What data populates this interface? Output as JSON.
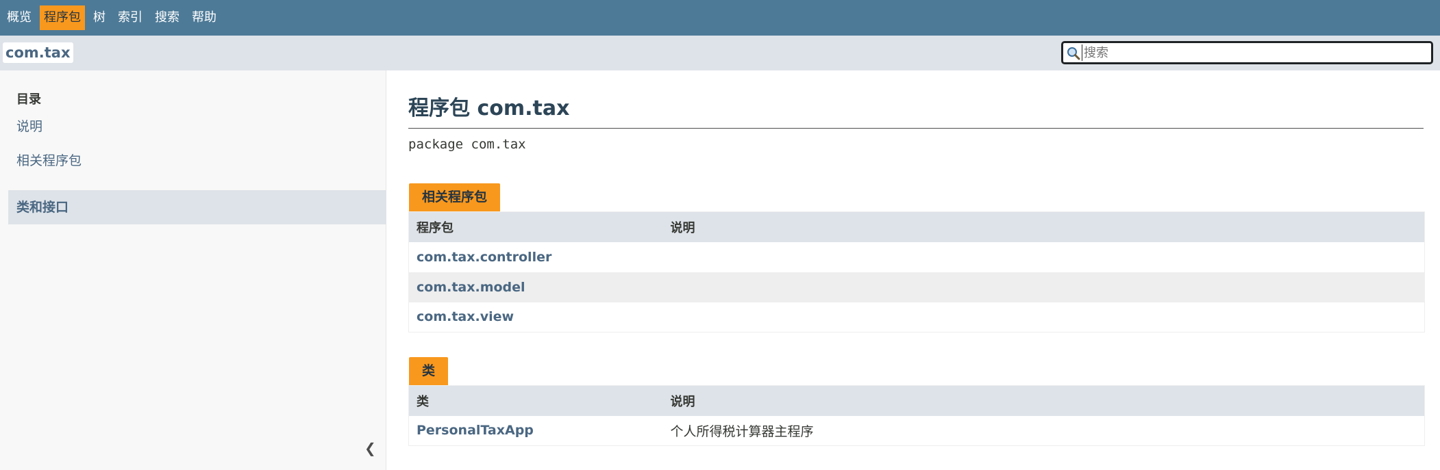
{
  "topnav": {
    "items": [
      {
        "label": "概览"
      },
      {
        "label": "程序包"
      },
      {
        "label": "树"
      },
      {
        "label": "索引"
      },
      {
        "label": "搜索"
      },
      {
        "label": "帮助"
      }
    ],
    "active_index": 1
  },
  "subnav": {
    "package_label": "com.tax",
    "search": {
      "placeholder": "搜索",
      "value": "",
      "icon": "search-icon"
    }
  },
  "sidebar": {
    "title": "目录",
    "items": [
      {
        "label": "说明"
      },
      {
        "label": "相关程序包"
      },
      {
        "label": "类和接口"
      }
    ],
    "active_index": 2,
    "collapse_glyph": "❮"
  },
  "main": {
    "title": "程序包 com.tax",
    "signature": "package com.tax",
    "related_packages": {
      "caption": "相关程序包",
      "headers": [
        "程序包",
        "说明"
      ],
      "rows": [
        {
          "name": "com.tax.controller",
          "desc": ""
        },
        {
          "name": "com.tax.model",
          "desc": ""
        },
        {
          "name": "com.tax.view",
          "desc": ""
        }
      ]
    },
    "classes": {
      "caption": "类",
      "headers": [
        "类",
        "说明"
      ],
      "rows": [
        {
          "name": "PersonalTaxApp",
          "desc": "个人所得税计算器主程序"
        }
      ]
    }
  },
  "colors": {
    "nav_bg": "#4d7a97",
    "accent": "#f8981d",
    "subnav_bg": "#dee3e9",
    "link": "#4a6782"
  }
}
